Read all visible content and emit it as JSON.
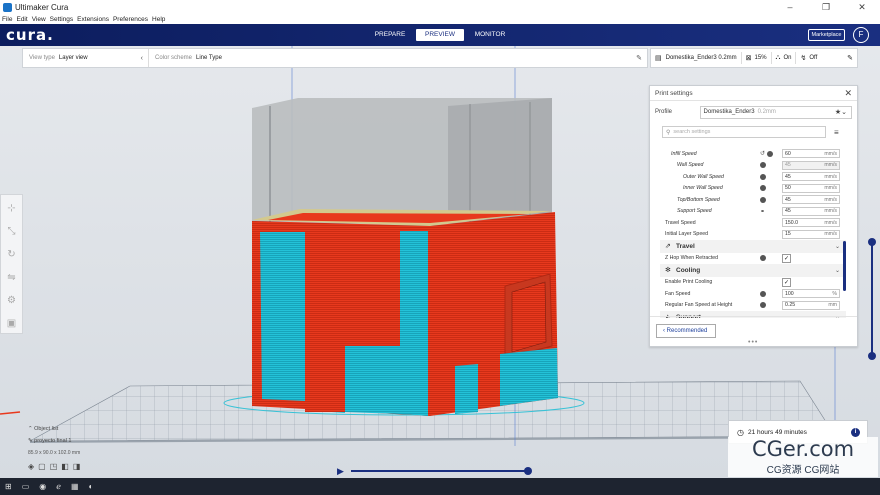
{
  "window": {
    "title": "Ultimaker Cura",
    "controls": [
      "–",
      "❐",
      "✕"
    ]
  },
  "menu": [
    "File",
    "Edit",
    "View",
    "Settings",
    "Extensions",
    "Preferences",
    "Help"
  ],
  "header": {
    "logo": "cura.",
    "stages": [
      "PREPARE",
      "PREVIEW",
      "MONITOR"
    ],
    "active_stage": "PREVIEW",
    "marketplace": "Marketplace",
    "account_initial": "F"
  },
  "viewbar": {
    "view_type_label": "View type",
    "view_type_value": "Layer view",
    "color_scheme_label": "Color scheme",
    "color_scheme_value": "Line Type"
  },
  "printerbar": {
    "printer": "Domestika_Ender3 0.2mm",
    "infill": "15%",
    "support": "On",
    "adhesion": "Off"
  },
  "print_settings": {
    "title": "Print settings",
    "profile_label": "Profile",
    "profile_value": "Domestika_Ender3",
    "profile_sub": "0.2mm",
    "search_placeholder": "search settings",
    "rows": [
      {
        "type": "setting",
        "name": "Infill Speed",
        "indent": 1,
        "value": "60",
        "unit": "mm/s",
        "reset": true,
        "fx": true
      },
      {
        "type": "setting",
        "name": "Wall Speed",
        "indent": 2,
        "value": "45",
        "unit": "mm/s",
        "disabled": true,
        "fx": true
      },
      {
        "type": "setting",
        "name": "Outer Wall Speed",
        "indent": 3,
        "value": "45",
        "unit": "mm/s",
        "fx": true
      },
      {
        "type": "setting",
        "name": "Inner Wall Speed",
        "indent": 3,
        "value": "50",
        "unit": "mm/s",
        "fx": true
      },
      {
        "type": "setting",
        "name": "Top/Bottom Speed",
        "indent": 2,
        "value": "45",
        "unit": "mm/s",
        "fx": true
      },
      {
        "type": "setting",
        "name": "Support Speed",
        "indent": 2,
        "value": "45",
        "unit": "mm/s",
        "link": true
      },
      {
        "type": "setting",
        "name": "Travel Speed",
        "indent": 0,
        "value": "150.0",
        "unit": "mm/s"
      },
      {
        "type": "setting",
        "name": "Initial Layer Speed",
        "indent": 0,
        "value": "15",
        "unit": "mm/s"
      },
      {
        "type": "category",
        "name": "Travel",
        "icon": "⇗"
      },
      {
        "type": "check",
        "name": "Z Hop When Retracted",
        "indent": 0,
        "checked": true,
        "fx": true
      },
      {
        "type": "category",
        "name": "Cooling",
        "icon": "✻"
      },
      {
        "type": "check",
        "name": "Enable Print Cooling",
        "indent": 0,
        "checked": true
      },
      {
        "type": "setting",
        "name": "Fan Speed",
        "indent": 0,
        "value": "100",
        "unit": "%",
        "fx": true
      },
      {
        "type": "setting",
        "name": "Regular Fan Speed at Height",
        "indent": 0,
        "value": "0.25",
        "unit": "mm",
        "fx": true
      },
      {
        "type": "category",
        "name": "Support",
        "icon": "◭"
      }
    ],
    "recommended_label": "Recommended"
  },
  "object_list": {
    "title": "Object list",
    "object_name": "proyecto final 1",
    "dimensions": "85.9 x 90.0 x 102.0 mm"
  },
  "estimate": {
    "time": "21 hours 49 minutes",
    "info": "i"
  },
  "watermark": {
    "line1": "CGer.com",
    "line2": "CG资源 CG网站"
  },
  "colors": {
    "header_bg": "#0c1d5e",
    "accent": "#1a2f80",
    "wall_red": "#e8391d",
    "skin_cyan": "#22c1d6",
    "shell_grey": "#b9bcbf"
  }
}
